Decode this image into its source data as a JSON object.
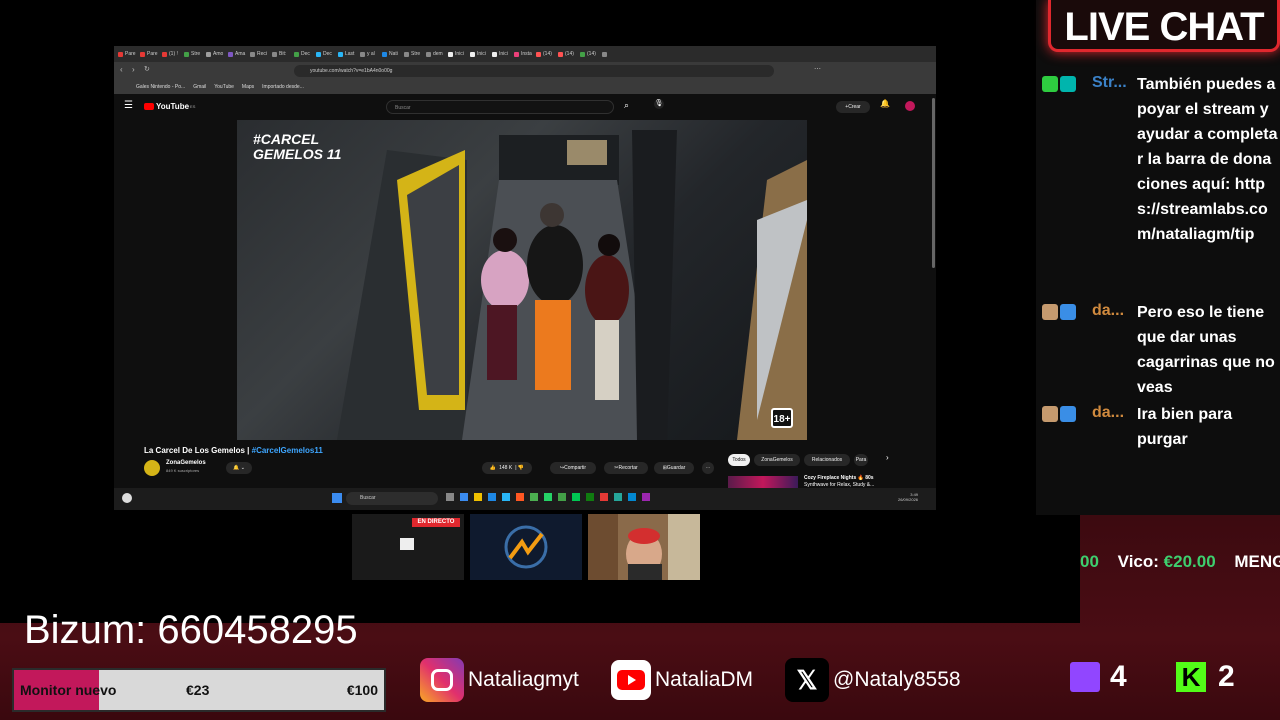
{
  "browser": {
    "tabs": [
      "Pare",
      "Pare",
      "(1) !",
      "Stre",
      "Amo",
      "Ama",
      "Reci",
      "Bit:",
      "Dec",
      "Dec",
      "Last",
      "y al",
      "Nati",
      "Stre",
      "dem",
      "Inici",
      "Inici",
      "Inici",
      "Insta",
      "(14)",
      "(14)",
      "(14)",
      ""
    ],
    "tab_colors": [
      "#e53935",
      "#e53935",
      "#e53935",
      "#43a047",
      "#9e9e9e",
      "#7e57c2",
      "#888",
      "#888",
      "#43a047",
      "#29b6f6",
      "#29b6f6",
      "#888",
      "#1e88e5",
      "#888",
      "#888",
      "#eee",
      "#eee",
      "#eee",
      "#ec407a",
      "#ff5252",
      "#ff5252",
      "#43a047",
      "#888"
    ],
    "url": "youtube.com/watch?v=e1bA4n0o00g",
    "bookmarks": [
      "Gales Nintendo - Po...",
      "Gmail",
      "YouTube",
      "Maps",
      "Importado desde..."
    ]
  },
  "youtube": {
    "logo": "YouTube",
    "logo_sup": "ES",
    "search_placeholder": "Buscar",
    "create_label": "Crear",
    "video_overlay_tag": "#CARCEL GEMELOS 11",
    "age_badge": "18+",
    "video_title_plain": "La Carcel De Los Gemelos | ",
    "video_title_tag": "#CarcelGemelos11",
    "channel_name": "ZonaGemelos",
    "subscribers": "849 K suscriptores",
    "likes": "148 K",
    "share": "Compartir",
    "clip": "Recortar",
    "save": "Guardar",
    "chips": [
      "Todos",
      "ZonaGemelos",
      "Relacionados",
      "Para"
    ],
    "rec_title": "Cozy Fireplace Nights 🔥 80s",
    "rec_sub": "Synthwave for Relax, Study &..."
  },
  "taskbar": {
    "search": "Buscar",
    "time": "3:49",
    "date": "26/09/2026"
  },
  "thumbs": {
    "live_badge": "EN DIRECTO"
  },
  "chat": {
    "title": "LIVE CHAT",
    "messages": [
      {
        "user": "Str...",
        "text": "También puedes apoyar el stream y ayudar a completar la barra de donaciones aquí: https://streamlabs.com/nataliagm/tip"
      },
      {
        "user": "da...",
        "text": "Pero eso le tiene que dar unas cagarrinas que no veas"
      },
      {
        "user": "da...",
        "text": "Ira bien para purgar"
      }
    ]
  },
  "ticker": {
    "left_amount": "00",
    "name": "Vico:",
    "amount": "€20.00",
    "next": "MENGA"
  },
  "overlay": {
    "bizum": "Bizum: 660458295",
    "goal_label": "Monitor nuevo",
    "goal_current": "€23",
    "goal_target": "€100",
    "goal_fraction": 0.23,
    "instagram": "Nataliagmyt",
    "youtube": "NataliaDM",
    "x": "@Nataly8558",
    "twitch_count": "4",
    "kick_count": "2"
  },
  "colors": {
    "accent_red": "#e0282e",
    "goal_fill": "#c2185b",
    "ticker_green": "#3ecf6e",
    "chat_user": "#3b82c8",
    "twitch": "#9146ff",
    "kick": "#53fc18"
  }
}
